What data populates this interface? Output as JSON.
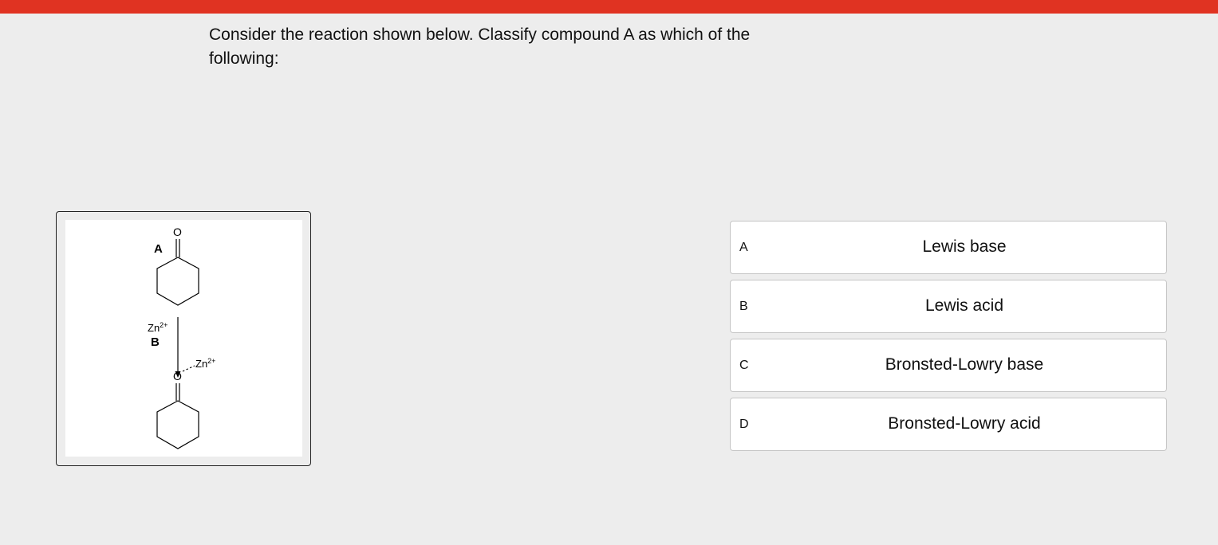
{
  "question": {
    "text": "Consider the reaction shown below. Classify compound A as which of the following:"
  },
  "figure": {
    "label_a": "A",
    "label_b": "B",
    "top_oxygen": "O",
    "bottom_oxygen": "O",
    "reagent": "Zn",
    "reagent_charge": "2+",
    "complex_metal": "Zn",
    "complex_charge": "2+"
  },
  "choices": [
    {
      "letter": "A",
      "text": "Lewis base"
    },
    {
      "letter": "B",
      "text": "Lewis acid"
    },
    {
      "letter": "C",
      "text": "Bronsted-Lowry base"
    },
    {
      "letter": "D",
      "text": "Bronsted-Lowry acid"
    }
  ],
  "colors": {
    "top_bar": "#e03322",
    "background": "#ededed"
  }
}
